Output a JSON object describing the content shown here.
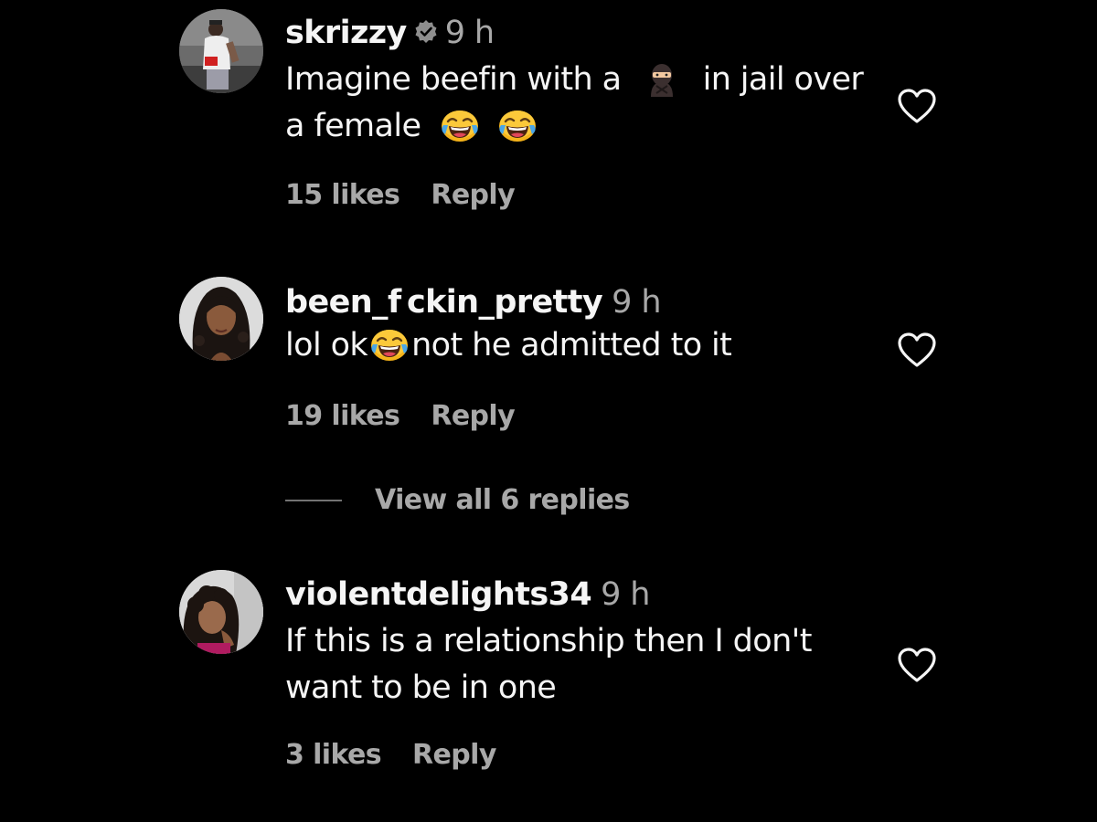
{
  "comments": [
    {
      "username": "skrizzy",
      "verified": true,
      "time": "9 h",
      "text_part1": "Imagine beefin with a",
      "text_part2": "in jail over",
      "text_part3": "a female",
      "emoji_1": "ninja",
      "emoji_2": "face-with-tears-of-joy",
      "likes": "15 likes",
      "reply_label": "Reply"
    },
    {
      "username": "been_f ckin_pretty",
      "verified": false,
      "time": "9 h",
      "text_part1": "lol ok",
      "text_part2": "not he admitted to it",
      "emoji_1": "face-with-tears-of-joy",
      "likes": "19 likes",
      "reply_label": "Reply",
      "view_replies": "View all 6 replies"
    },
    {
      "username": "violentdelights34",
      "verified": false,
      "time": "9 h",
      "text_line1": "If this is a relationship then I don't",
      "text_line2": "want to be in one",
      "likes": "3 likes",
      "reply_label": "Reply"
    }
  ],
  "colors": {
    "background": "#000000",
    "primary_text": "#f5f5f5",
    "secondary_text": "#a8a8a8"
  },
  "icons": {
    "like": "heart-outline-icon",
    "verified": "verified-badge-icon"
  }
}
